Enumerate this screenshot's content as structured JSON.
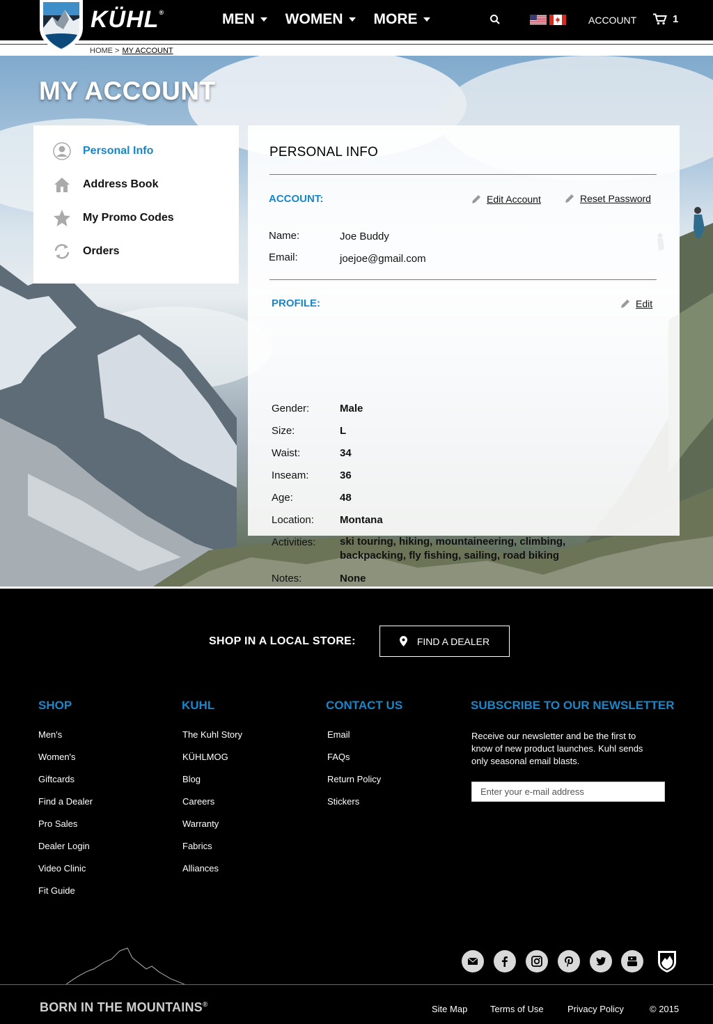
{
  "header": {
    "logo_text": "KÜHL",
    "nav": [
      {
        "label": "MEN"
      },
      {
        "label": "WOMEN"
      },
      {
        "label": "MORE"
      }
    ],
    "account_label": "ACCOUNT",
    "cart_count": "1"
  },
  "breadcrumb": {
    "home": "HOME >",
    "current": "MY ACCOUNT"
  },
  "page_title": "MY ACCOUNT",
  "sidebar": {
    "items": [
      {
        "label": "Personal Info",
        "icon": "user-icon",
        "active": true
      },
      {
        "label": "Address Book",
        "icon": "home-icon",
        "active": false
      },
      {
        "label": "My Promo Codes",
        "icon": "star-icon",
        "active": false
      },
      {
        "label": "Orders",
        "icon": "refresh-icon",
        "active": false
      }
    ]
  },
  "personal_info": {
    "title": "PERSONAL INFO",
    "account": {
      "label": "ACCOUNT:",
      "edit_account": "Edit Account",
      "reset_password": "Reset Password",
      "fields": [
        {
          "label": "Name:",
          "value": "Joe Buddy"
        },
        {
          "label": "Email:",
          "value": "joejoe@gmail.com"
        }
      ]
    },
    "profile": {
      "label": "PROFILE:",
      "edit": "Edit",
      "fields": [
        {
          "label": "Gender:",
          "value": "Male"
        },
        {
          "label": "Size:",
          "value": "L"
        },
        {
          "label": "Waist:",
          "value": "34"
        },
        {
          "label": "Inseam:",
          "value": "36"
        },
        {
          "label": "Age:",
          "value": "48"
        },
        {
          "label": "Location:",
          "value": "Montana"
        },
        {
          "label": "Activities:",
          "value": "ski touring, hiking, mountaineering, climbing, backpacking, fly fishing, sailing, road biking"
        },
        {
          "label": "Notes:",
          "value": "None"
        }
      ]
    }
  },
  "footer": {
    "shop_local": "SHOP IN A LOCAL STORE:",
    "find_dealer": "FIND A DEALER",
    "columns": [
      {
        "heading": "SHOP",
        "links": [
          "Men's",
          "Women's",
          "Giftcards",
          "Find a Dealer",
          "Pro Sales",
          "Dealer Login",
          "Video Clinic",
          "Fit Guide"
        ]
      },
      {
        "heading": "KUHL",
        "links": [
          "The Kuhl Story",
          "KÜHLMOG",
          "Blog",
          "Careers",
          "Warranty",
          "Fabrics",
          "Alliances"
        ]
      },
      {
        "heading": "CONTACT US",
        "links": [
          "Email",
          "FAQs",
          "Return Policy",
          "Stickers"
        ]
      }
    ],
    "newsletter": {
      "heading": "SUBSCRIBE TO OUR NEWSLETTER",
      "text": "Receive our newsletter and be the first to know of new product launches. Kuhl sends only seasonal email blasts.",
      "placeholder": "Enter your e-mail address"
    },
    "social": [
      "email-icon",
      "facebook-icon",
      "instagram-icon",
      "pinterest-icon",
      "twitter-icon",
      "youtube-icon"
    ],
    "tagline": "BORN IN THE MOUNTAINS",
    "tagline_mark": "®",
    "bottom_links": [
      "Site Map",
      "Terms of Use",
      "Privacy Policy",
      "© 2015"
    ]
  },
  "colors": {
    "accent": "#1a86c8",
    "background": "#000000"
  }
}
